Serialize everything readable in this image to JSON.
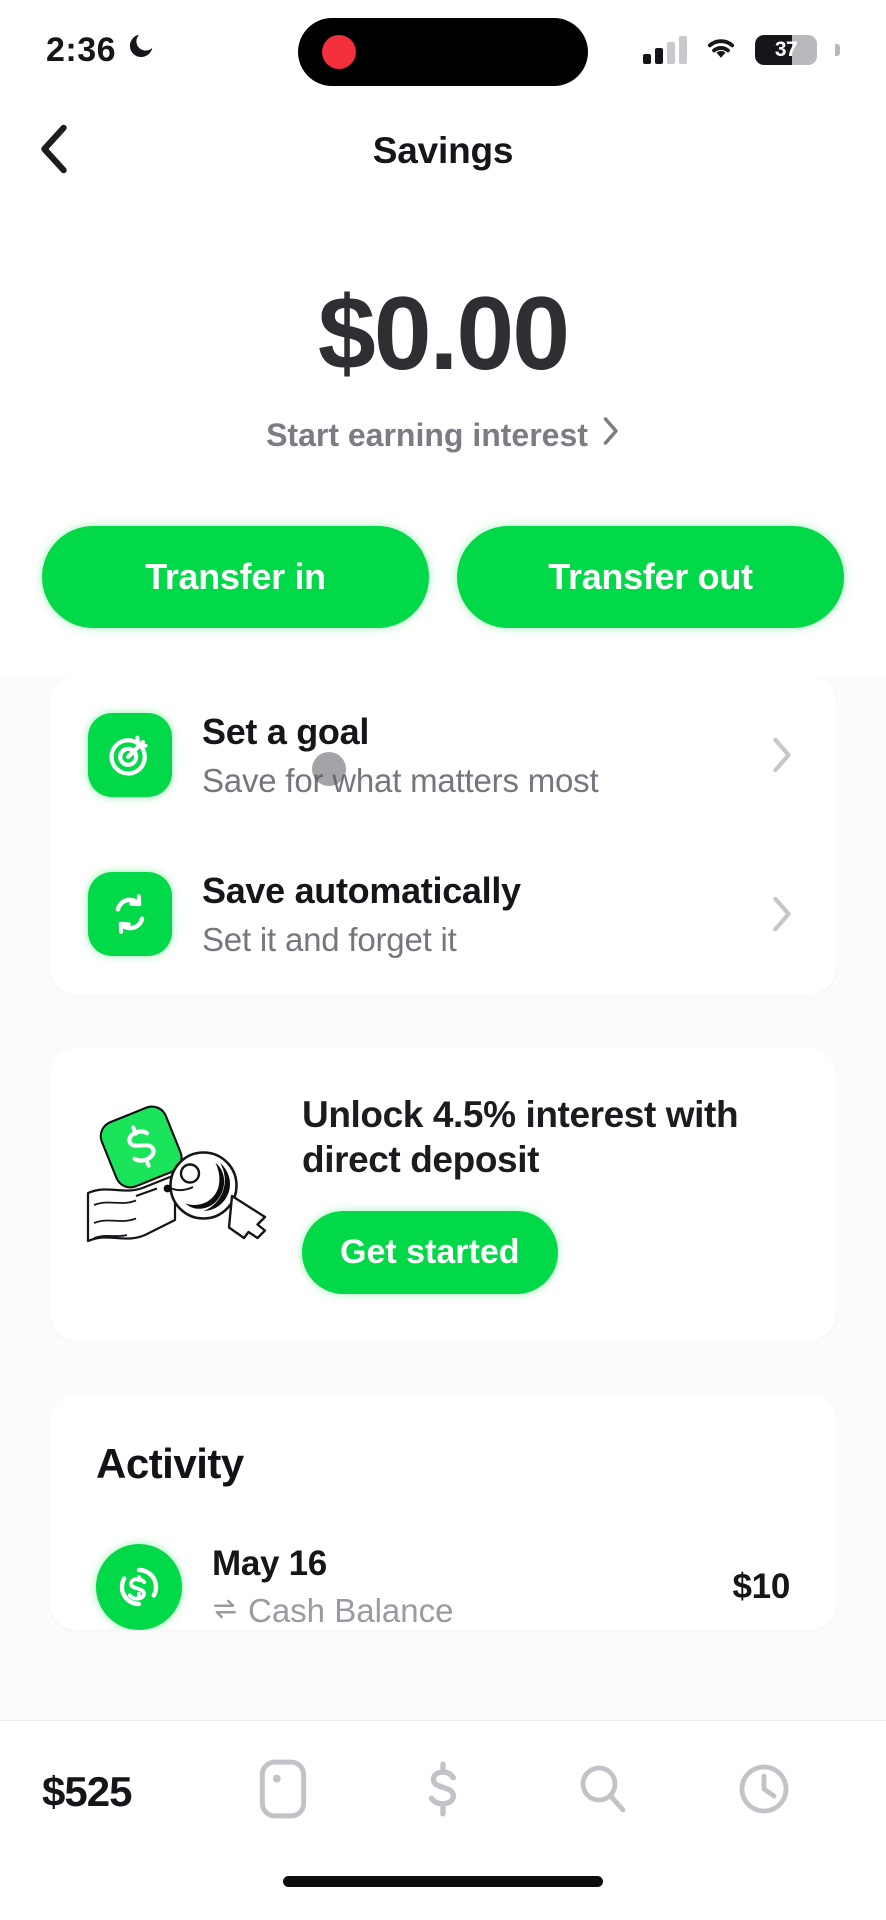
{
  "status_bar": {
    "time": "2:36",
    "moon_icon": "crescent-moon-icon",
    "signal_icon": "cellular-signal-icon",
    "wifi_icon": "wifi-icon",
    "battery_percent": "37",
    "battery_level": 37
  },
  "header": {
    "back_icon": "chevron-left-icon",
    "title": "Savings"
  },
  "balance": {
    "amount": "$0.00",
    "interest_link": "Start earning interest",
    "interest_chevron_icon": "chevron-right-icon"
  },
  "actions": {
    "transfer_in": "Transfer in",
    "transfer_out": "Transfer out"
  },
  "promo_rows": [
    {
      "icon": "goal-target-icon",
      "title": "Set a goal",
      "subtitle": "Save for what matters most",
      "chevron_icon": "chevron-right-icon"
    },
    {
      "icon": "auto-repeat-icon",
      "title": "Save automatically",
      "subtitle": "Set it and forget it",
      "chevron_icon": "chevron-right-icon"
    }
  ],
  "interest_promo": {
    "illustration": "hand-cash-key-illustration",
    "title": "Unlock 4.5% interest with direct deposit",
    "cta_label": "Get started"
  },
  "activity": {
    "heading": "Activity",
    "rows": [
      {
        "icon": "cash-app-dollar-icon",
        "date": "May 16",
        "source_icon": "transfer-arrows-icon",
        "source": "Cash Balance",
        "amount": "$10"
      }
    ]
  },
  "tab_bar": {
    "balance": "$525",
    "items": [
      {
        "name": "card-icon"
      },
      {
        "name": "dollar-icon"
      },
      {
        "name": "search-icon"
      },
      {
        "name": "clock-icon"
      }
    ]
  },
  "colors": {
    "brand_green": "#01d948",
    "text_primary": "#15151a",
    "text_secondary": "#76767e",
    "page_bg": "#fbfbfb",
    "card_bg": "#ffffff"
  }
}
